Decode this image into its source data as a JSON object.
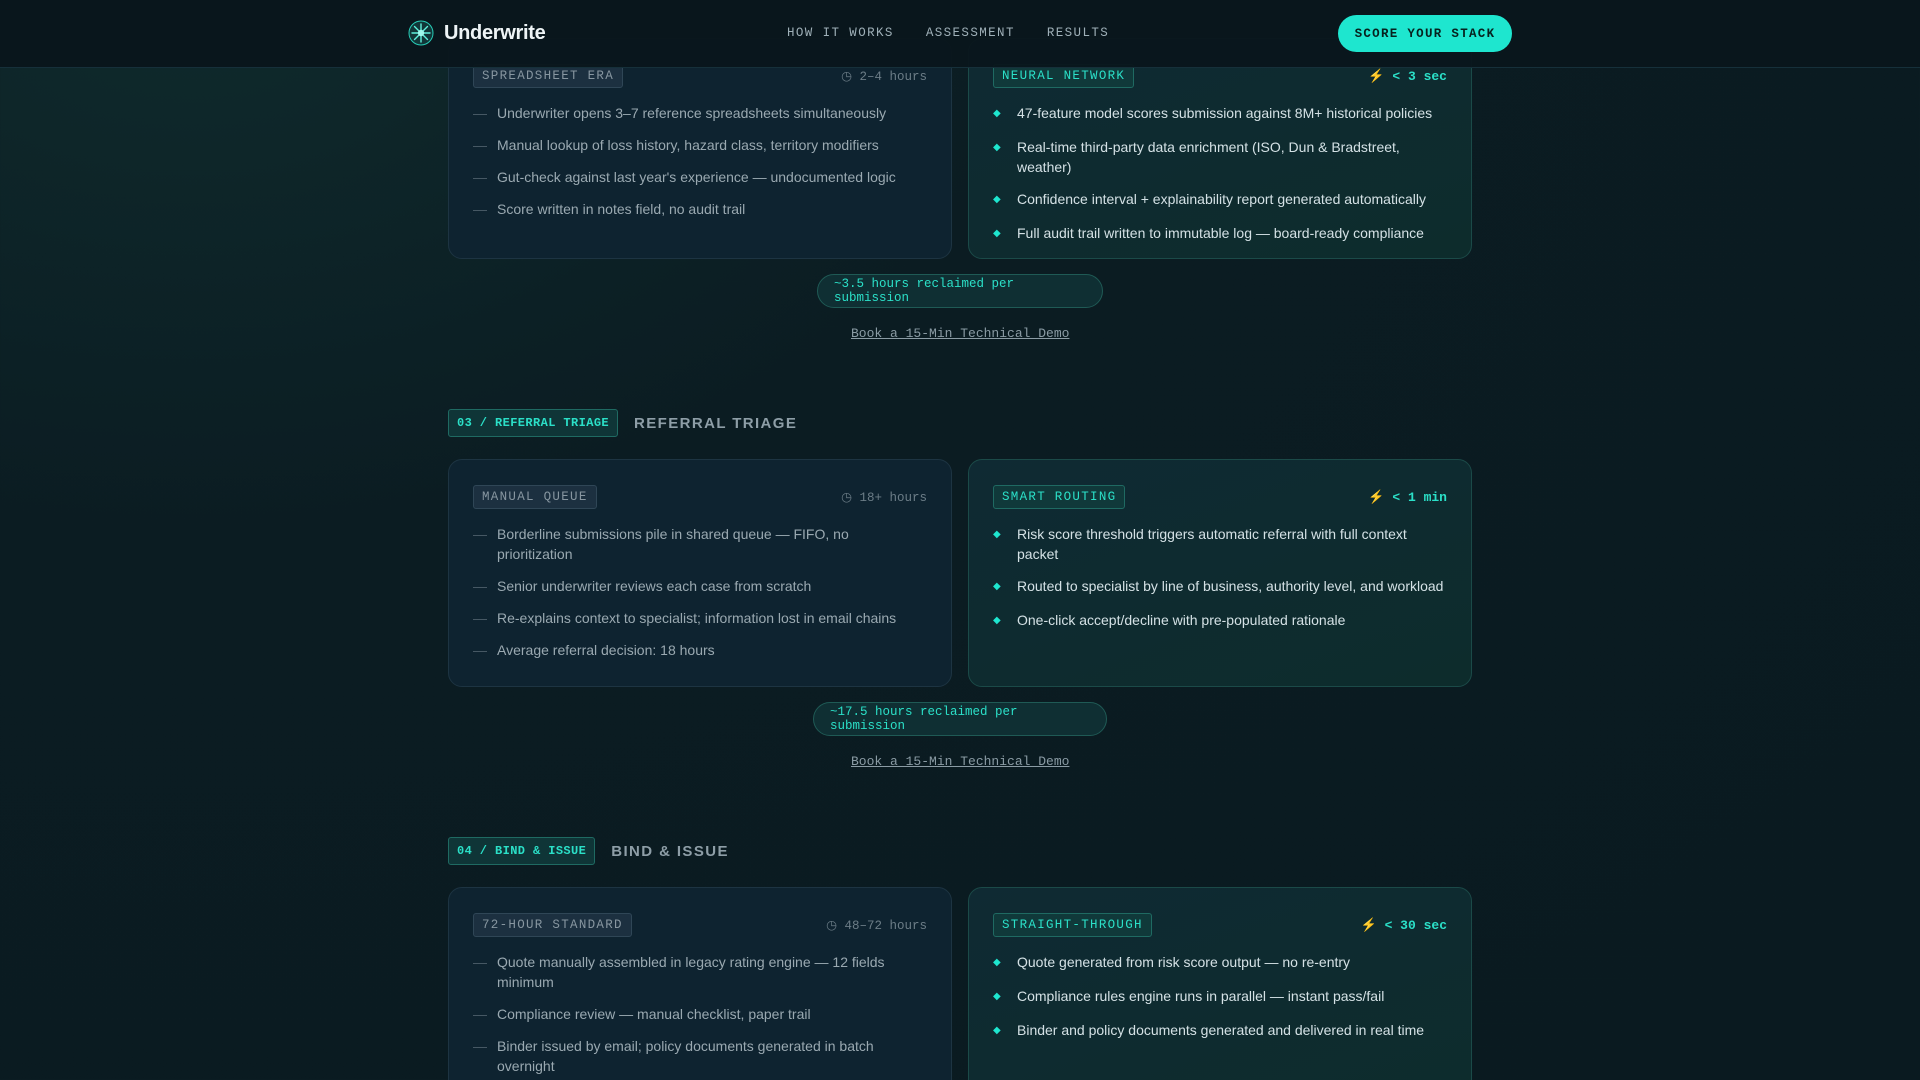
{
  "nav": {
    "brand": "Underwrite",
    "links": [
      "HOW IT WORKS",
      "ASSESSMENT",
      "RESULTS"
    ],
    "cta": "SCORE YOUR STACK"
  },
  "colors": {
    "accent": "#1ee6cf",
    "background": "#0b1c22",
    "card": "#0e2330"
  },
  "sections": [
    {
      "manual": {
        "tag": "SPREADSHEET ERA",
        "time": "◷ 2–4 hours",
        "items": [
          "Underwriter opens 3–7 reference spreadsheets simultaneously",
          "Manual lookup of loss history, hazard class, territory modifiers",
          "Gut-check against last year's experience — undocumented logic",
          "Score written in notes field, no audit trail"
        ]
      },
      "smart": {
        "tag": "NEURAL NETWORK",
        "time": "⚡ < 3 sec",
        "items": [
          "47-feature model scores submission against 8M+ historical policies",
          "Real-time third-party data enrichment (ISO, Dun & Bradstreet, weather)",
          "Confidence interval + explainability report generated automatically",
          "Full audit trail written to immutable log — board-ready compliance"
        ]
      },
      "reclaimed": "~3.5 hours reclaimed per submission",
      "demo": "Book a 15-Min Technical Demo"
    },
    {
      "badge": "03 / REFERRAL TRIAGE",
      "title": "REFERRAL TRIAGE",
      "manual": {
        "tag": "MANUAL QUEUE",
        "time": "◷ 18+ hours",
        "items": [
          "Borderline submissions pile in shared queue — FIFO, no prioritization",
          "Senior underwriter reviews each case from scratch",
          "Re-explains context to specialist; information lost in email chains",
          "Average referral decision: 18 hours"
        ]
      },
      "smart": {
        "tag": "SMART ROUTING",
        "time": "⚡ < 1 min",
        "items": [
          "Risk score threshold triggers automatic referral with full context packet",
          "Routed to specialist by line of business, authority level, and workload",
          "One-click accept/decline with pre-populated rationale"
        ]
      },
      "reclaimed": "~17.5 hours reclaimed per submission",
      "demo": "Book a 15-Min Technical Demo"
    },
    {
      "badge": "04 / BIND & ISSUE",
      "title": "BIND & ISSUE",
      "manual": {
        "tag": "72-HOUR STANDARD",
        "time": "◷ 48–72 hours",
        "items": [
          "Quote manually assembled in legacy rating engine — 12 fields minimum",
          "Compliance review — manual checklist, paper trail",
          "Binder issued by email; policy documents generated in batch overnight"
        ]
      },
      "smart": {
        "tag": "STRAIGHT-THROUGH",
        "time": "⚡ < 30 sec",
        "items": [
          "Quote generated from risk score output — no re-entry",
          "Compliance rules engine runs in parallel — instant pass/fail",
          "Binder and policy documents generated and delivered in real time"
        ]
      }
    }
  ]
}
